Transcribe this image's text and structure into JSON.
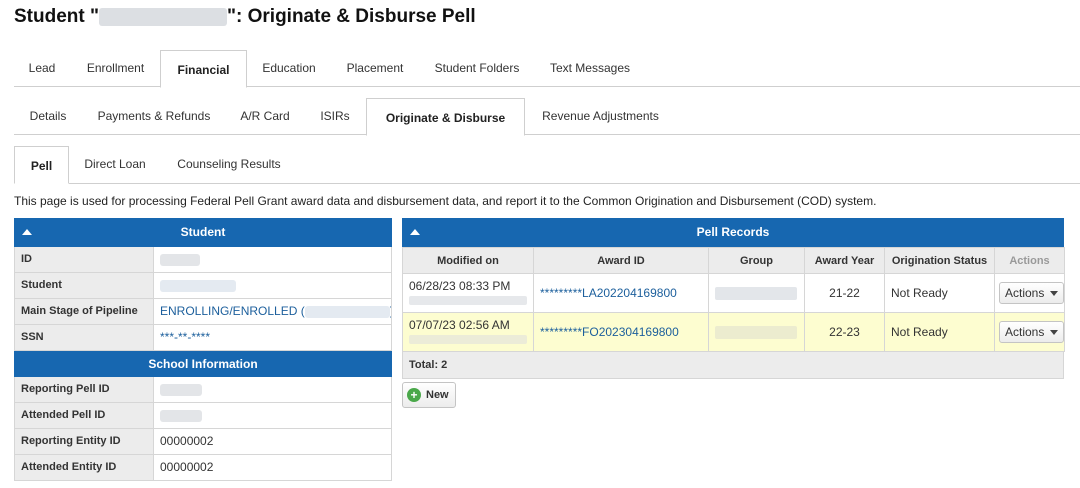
{
  "header": {
    "title_prefix": "Student \"",
    "title_suffix": "\": Originate & Disburse Pell"
  },
  "tabs_main": [
    "Lead",
    "Enrollment",
    "Financial",
    "Education",
    "Placement",
    "Student Folders",
    "Text Messages"
  ],
  "tabs_financial": [
    "Details",
    "Payments & Refunds",
    "A/R Card",
    "ISIRs",
    "Originate & Disburse",
    "Revenue Adjustments"
  ],
  "tabs_origination": [
    "Pell",
    "Direct Loan",
    "Counseling Results"
  ],
  "description": "This page is used for processing Federal Pell Grant award data and disbursement data, and report it to the Common Origination and Disbursement (COD) system.",
  "student_panel": {
    "title": "Student",
    "rows": {
      "id_label": "ID",
      "student_label": "Student",
      "stage_label": "Main Stage of Pipeline",
      "stage_value_prefix": "ENROLLING/ENROLLED (",
      "stage_value_suffix": ")",
      "ssn_label": "SSN",
      "ssn_value": "***-**-****"
    },
    "school_title": "School Information",
    "school_rows": {
      "reporting_pell_label": "Reporting Pell ID",
      "attended_pell_label": "Attended Pell ID",
      "reporting_entity_label": "Reporting Entity ID",
      "reporting_entity_value": "00000002",
      "attended_entity_label": "Attended Entity ID",
      "attended_entity_value": "00000002"
    }
  },
  "pell_panel": {
    "title": "Pell Records",
    "columns": [
      "Modified on",
      "Award ID",
      "Group",
      "Award Year",
      "Origination Status",
      "Actions"
    ],
    "rows": [
      {
        "modified": "06/28/23 08:33 PM",
        "award_id": "*********LA202204169800",
        "award_year": "21-22",
        "status": "Not Ready",
        "action": "Actions"
      },
      {
        "modified": "07/07/23 02:56 AM",
        "award_id": "*********FO202304169800",
        "award_year": "22-23",
        "status": "Not Ready",
        "action": "Actions"
      }
    ],
    "total": "Total: 2",
    "new_label": "New"
  },
  "colors": {
    "panel_header": "#1767b0",
    "link": "#1c5f9c",
    "highlight_row": "#fdfdd0"
  }
}
